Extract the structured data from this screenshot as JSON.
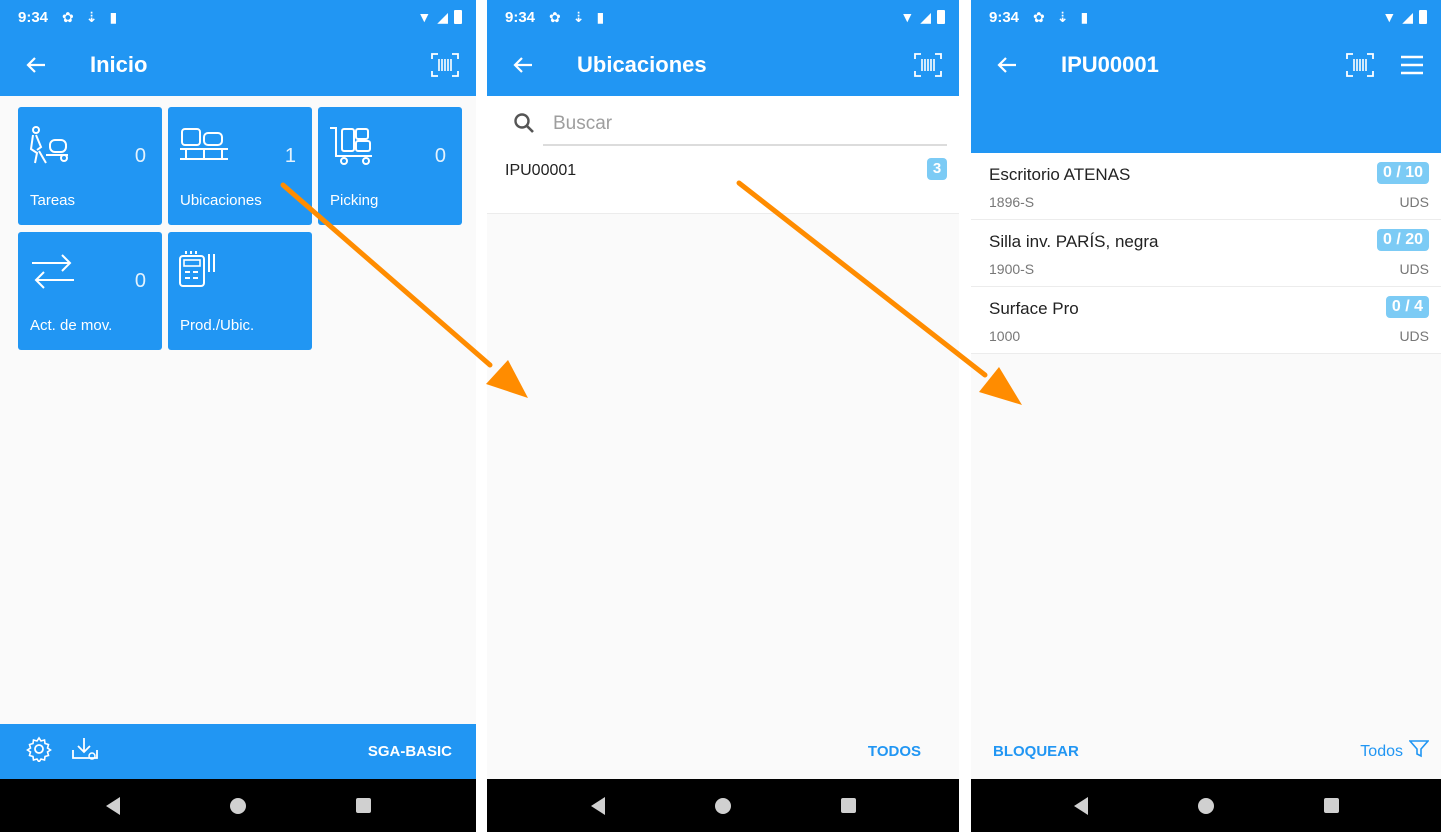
{
  "status_bar": {
    "time": "9:34"
  },
  "screen1": {
    "title": "Inicio",
    "tiles": [
      {
        "label": "Tareas",
        "count": "0",
        "icon": "worker-cart-icon"
      },
      {
        "label": "Ubicaciones",
        "count": "1",
        "icon": "pallet-boxes-icon"
      },
      {
        "label": "Picking",
        "count": "0",
        "icon": "trolley-boxes-icon"
      },
      {
        "label": "Act. de mov.",
        "count": "0",
        "icon": "transfer-arrows-icon"
      },
      {
        "label": "Prod./Ubic.",
        "count": "",
        "icon": "calculator-barcode-icon"
      }
    ],
    "footer_label": "SGA-BASIC"
  },
  "screen2": {
    "title": "Ubicaciones",
    "search_placeholder": "Buscar",
    "locations": [
      {
        "code": "IPU00001",
        "count": "3"
      }
    ],
    "footer_label": "TODOS"
  },
  "screen3": {
    "title": "IPU00001",
    "products": [
      {
        "name": "Escritorio ATENAS",
        "code": "1896-S",
        "qty": "0 / 10",
        "unit": "UDS"
      },
      {
        "name": "Silla inv. PARÍS, negra",
        "code": "1900-S",
        "qty": "0 / 20",
        "unit": "UDS"
      },
      {
        "name": "Surface Pro",
        "code": "1000",
        "qty": "0 / 4",
        "unit": "UDS"
      }
    ],
    "footer_left": "BLOQUEAR",
    "footer_right": "Todos"
  },
  "colors": {
    "primary": "#2196f3",
    "badge": "#7ccbf5",
    "arrow": "#ff8c00"
  }
}
